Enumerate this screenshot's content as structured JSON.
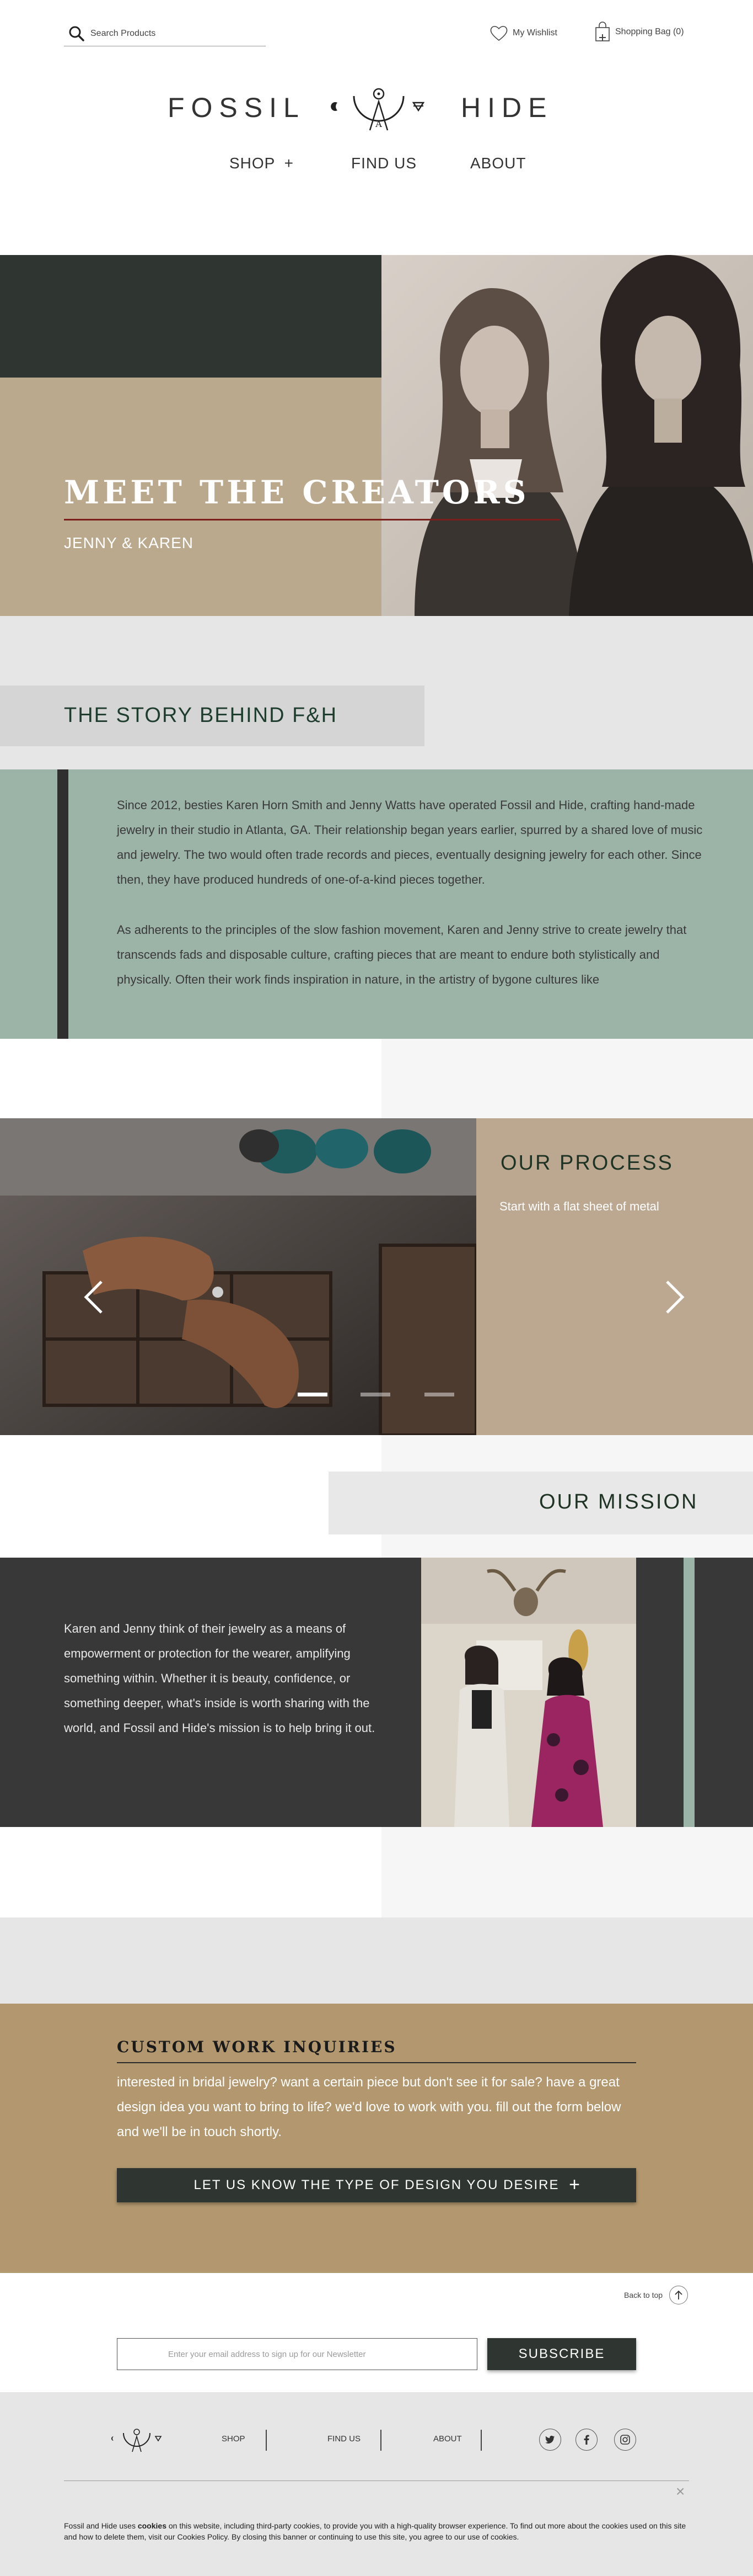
{
  "header": {
    "search_placeholder": "Search Products",
    "wishlist_label": "My Wishlist",
    "bag_label": "Shopping Bag (0)"
  },
  "logo": {
    "left": "FOSSIL",
    "right": "HIDE",
    "mark_letter": "A"
  },
  "nav": {
    "shop": "SHOP",
    "shop_plus": "+",
    "find_us": "FIND US",
    "about": "ABOUT"
  },
  "hero": {
    "title": "MEET THE CREATORS",
    "subtitle": "JENNY & KAREN"
  },
  "story": {
    "title": "THE STORY BEHIND F&H",
    "paragraphs": [
      "Since 2012, besties Karen Horn Smith and Jenny Watts have operated Fossil and Hide, crafting hand-made jewelry in their studio in Atlanta, GA. Their relationship began years earlier, spurred by a shared love of music and jewelry. The two would often trade records and pieces, eventually designing jewelry for each other. Since then, they have produced hundreds of one-of-a-kind pieces together.",
      "As adherents to the principles of the slow fashion movement, Karen and Jenny strive to create jewelry that transcends fads and disposable culture, crafting pieces that are meant to endure both stylistically and physically. Often their work finds inspiration in nature, in the artistry of bygone cultures like"
    ]
  },
  "process": {
    "title": "OUR PROCESS",
    "subtitle": "Start with a flat sheet of metal",
    "slide_index": 1,
    "slide_count": 3
  },
  "mission": {
    "title": "OUR MISSION",
    "text": "Karen and Jenny think of their jewelry as a means of empowerment or protection for the wearer, amplifying something within. Whether it is beauty, confidence, or something deeper, what's inside is worth sharing with the world, and Fossil and Hide's mission is to help bring it out."
  },
  "custom": {
    "title": "CUSTOM WORK INQUIRIES",
    "text": "interested in bridal jewelry? want a certain piece but don't see it for sale? have a great design idea you want to bring to life? we'd love to work with you. fill out the form below and we'll be in touch shortly.",
    "button_label": "LET US KNOW THE TYPE OF DESIGN YOU DESIRE",
    "button_plus": "+"
  },
  "back_to_top": "Back to top",
  "newsletter": {
    "placeholder": "Enter your email address to sign up for our Newsletter",
    "button_label": "SUBSCRIBE"
  },
  "footer": {
    "links": {
      "shop": "SHOP",
      "find_us": "FIND US",
      "about": "ABOUT"
    },
    "social": [
      "twitter-icon",
      "facebook-icon",
      "instagram-icon"
    ],
    "cookie_close": "×",
    "cookie_prefix": "Fossil and Hide uses ",
    "cookie_bold": "cookies",
    "cookie_rest": " on this website, including third-party cookies, to provide you with a high-quality browser experience. To find out more about the cookies used on this site and how to delete them, visit our Cookies Policy. By closing this banner or continuing to use this site, you agree to our use of cookies."
  },
  "colors": {
    "dark_green": "#2f3632",
    "tan": "#bba98e",
    "sage": "#9cb3a8",
    "charcoal": "#383838",
    "gold": "#b3986f",
    "accent_red": "#7a1f1c"
  }
}
